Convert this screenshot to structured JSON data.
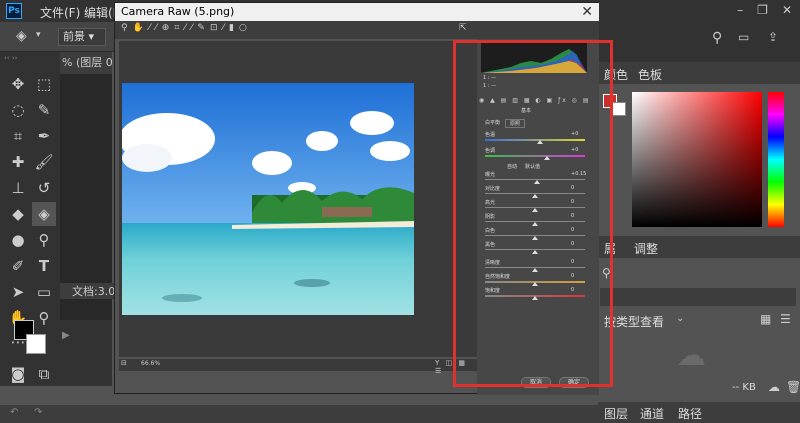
{
  "app": {
    "logo": "Ps",
    "menu": [
      "文件(F)",
      "编辑(E"
    ],
    "window_controls": [
      "–",
      "❐",
      "✕"
    ]
  },
  "options": {
    "fg_mode": "前景"
  },
  "document": {
    "tab_label": "% (图层 0,",
    "status": "文档:3.0"
  },
  "camera_raw": {
    "title": "Camera Raw (5.png)",
    "histogram_readouts": [
      "1 : —",
      "1 : —"
    ],
    "section_title": "基本",
    "white_balance_label": "白平衡",
    "white_balance_value": "原照",
    "sliders": [
      {
        "label": "色温",
        "value": "+0",
        "pos": 0.55
      },
      {
        "label": "色调",
        "value": "+0",
        "pos": 0.62
      },
      {
        "label": "曝光",
        "value": "+0.15",
        "pos": 0.52
      },
      {
        "label": "对比度",
        "value": "0",
        "pos": 0.5
      },
      {
        "label": "高光",
        "value": "0",
        "pos": 0.5
      },
      {
        "label": "阴影",
        "value": "0",
        "pos": 0.5
      },
      {
        "label": "白色",
        "value": "0",
        "pos": 0.5
      },
      {
        "label": "黑色",
        "value": "0",
        "pos": 0.5
      },
      {
        "label": "清晰度",
        "value": "0",
        "pos": 0.5
      },
      {
        "label": "自然饱和度",
        "value": "0",
        "pos": 0.5
      },
      {
        "label": "饱和度",
        "value": "0",
        "pos": 0.5
      }
    ],
    "auto_label": "自动",
    "default_label": "默认值",
    "zoom": "66.6%",
    "cancel_label": "取消",
    "ok_label": "确定"
  },
  "panels": {
    "color_tabs": [
      "颜色",
      "色板"
    ],
    "props_tabs": [
      "属",
      "调整"
    ],
    "view_dropdown": "按类型查看",
    "file_size": "-- KB",
    "layers_tabs": [
      "图层",
      "通道",
      "路径"
    ]
  }
}
